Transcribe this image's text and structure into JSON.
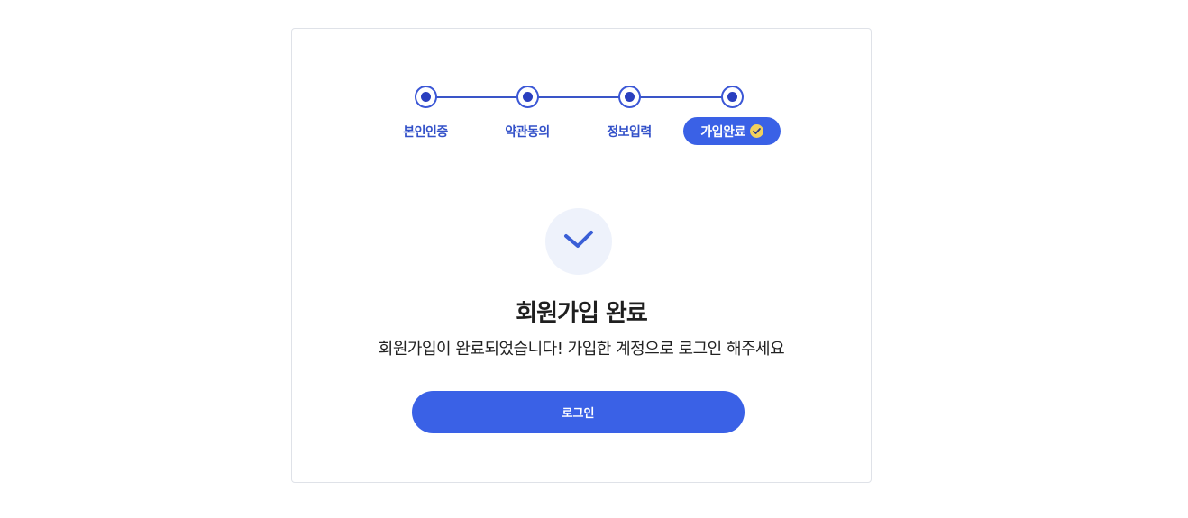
{
  "stepper": {
    "steps": [
      {
        "label": "본인인증",
        "state": "done"
      },
      {
        "label": "약관동의",
        "state": "done"
      },
      {
        "label": "정보입력",
        "state": "done"
      },
      {
        "label": "가입완료",
        "state": "current"
      }
    ],
    "current_icon": "check-circle-icon"
  },
  "result": {
    "icon": "checkmark-icon",
    "title": "회원가입 완료",
    "message": "회원가입이 완료되었습니다! 가입한 계정으로 로그인 해주세요"
  },
  "actions": {
    "login_label": "로그인"
  },
  "colors": {
    "accent": "#3a61e6",
    "step_dot": "#2a3fbf",
    "step_label": "#3351c9",
    "icon_bg": "#eef2fb",
    "pill_check": "#f2d15c"
  }
}
